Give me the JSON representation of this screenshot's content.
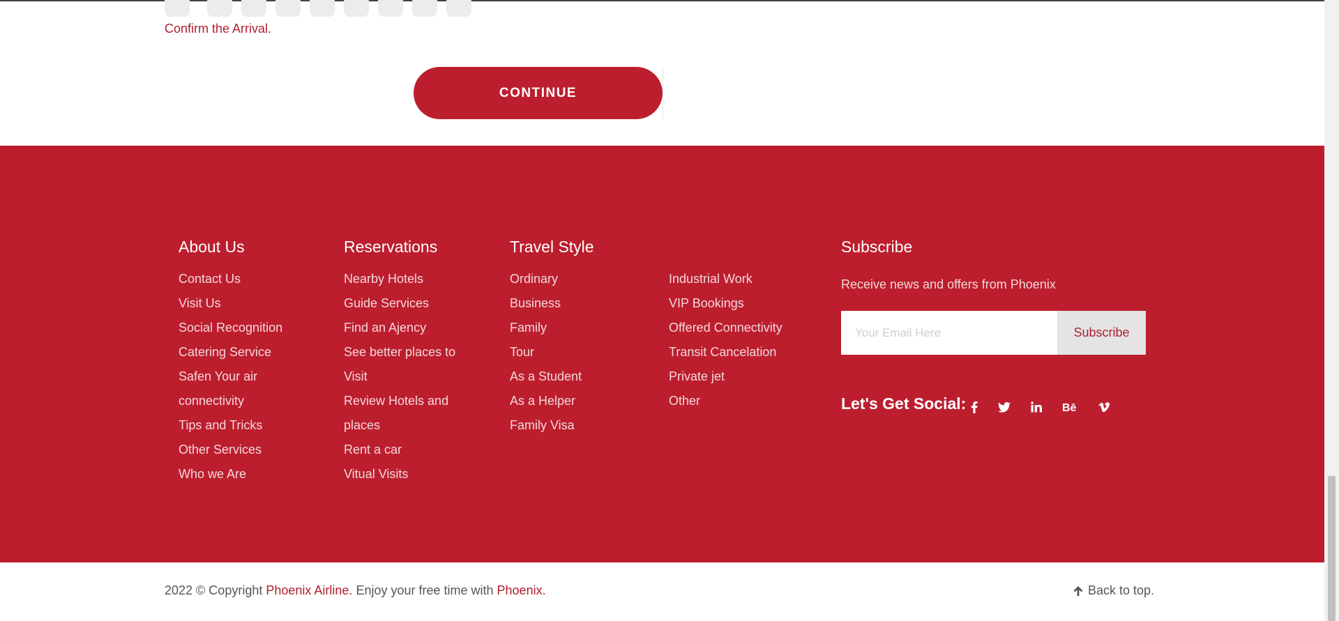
{
  "form": {
    "confirm_text": "Confirm the Arrival.",
    "continue_label": "CONTINUE"
  },
  "footer": {
    "about": {
      "title": "About Us",
      "items": [
        "Contact Us",
        "Visit Us",
        "Social Recognition",
        "Catering Service",
        "Safen Your air",
        "connectivity",
        "Tips and Tricks",
        "Other Services",
        "Who we Are"
      ]
    },
    "reservations": {
      "title": "Reservations",
      "items": [
        "Nearby Hotels",
        "Guide Services",
        "Find an Ajency",
        "See better places to",
        "Visit",
        "Review Hotels and",
        "places",
        "Rent a car",
        "Vitual Visits"
      ]
    },
    "travel_style": {
      "title": "Travel Style",
      "items_left": [
        "Ordinary",
        "Business",
        "Family",
        "Tour",
        "As a Student",
        "As a Helper",
        "Family Visa"
      ],
      "items_right": [
        "Industrial Work",
        "VIP Bookings",
        "Offered Connectivity",
        "Transit Cancelation",
        "Private jet",
        "Other"
      ]
    },
    "subscribe": {
      "title": "Subscribe",
      "description": "Receive news and offers from Phoenix",
      "email_placeholder": "Your Email Here",
      "button_label": "Subscribe"
    },
    "social": {
      "label": "Let's Get Social:",
      "icons": [
        "facebook-icon",
        "twitter-icon",
        "linkedin-icon",
        "behance-icon",
        "vimeo-icon"
      ]
    }
  },
  "bottom": {
    "copyright_prefix": "2022 © Copyright ",
    "brand_link": "Phoenix Airline.",
    "copyright_middle": " Enjoy your free time with ",
    "brand_link2": "Phoenix.",
    "back_to_top": "Back to top."
  },
  "colors": {
    "brand_red": "#bc1e2e",
    "link_red": "#b01e2f"
  }
}
